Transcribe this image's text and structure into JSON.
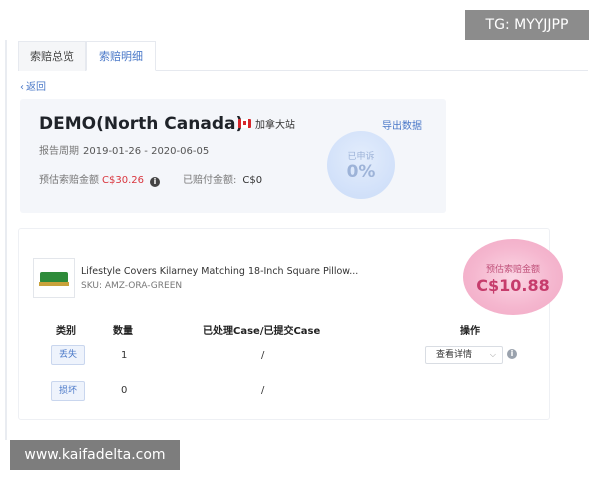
{
  "tabs": [
    {
      "label": "索赔总览"
    },
    {
      "label": "索赔明细"
    }
  ],
  "back_label": "返回",
  "summary": {
    "shop_title": "DEMO(North Canada)",
    "region": "加拿大站",
    "export_label": "导出数据",
    "period_label": "报告周期",
    "period_value": "2019-01-26 - 2020-06-05",
    "estimated_label": "预估索赔金额",
    "estimated_value": "C$30.26",
    "paid_label": "已赔付金额:",
    "paid_value": "C$0",
    "appeal_caption": "已申诉",
    "appeal_percent": "0%"
  },
  "product": {
    "name": "Lifestyle Covers Kilarney Matching 18-Inch Square Pillow...",
    "sku": "SKU: AMZ-ORA-GREEN",
    "estimated_caption": "预估索赔金额",
    "estimated_value": "C$10.88",
    "headers": [
      "类别",
      "数量",
      "已处理Case/已提交Case",
      "操作"
    ],
    "rows": [
      {
        "category": "丢失",
        "qty": "1",
        "ratio": "/",
        "action": "查看详情"
      },
      {
        "category": "损坏",
        "qty": "0",
        "ratio": "/"
      }
    ]
  },
  "overlays": {
    "tg": "TG: MYYJJPP",
    "watermark": "www.kaifadelta.com"
  },
  "colors": {
    "accent": "#4a78c8",
    "amount_red": "#d9363e",
    "bubble_pink": "#f5b7cf",
    "bubble_blue": "#d5e3fa"
  }
}
